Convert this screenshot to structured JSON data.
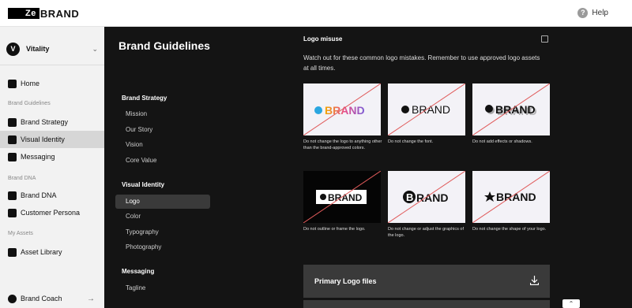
{
  "brand": {
    "logo_box": "Ze",
    "logo_rest": "BRAND"
  },
  "header": {
    "help_label": "Help",
    "help_glyph": "?"
  },
  "account": {
    "initial": "V",
    "name": "Vitality"
  },
  "sidebar": {
    "home": "Home",
    "section_guidelines": "Brand Guidelines",
    "brand_strategy": "Brand Strategy",
    "visual_identity": "Visual Identity",
    "messaging": "Messaging",
    "section_dna": "Brand DNA",
    "brand_dna": "Brand DNA",
    "customer_persona": "Customer Persona",
    "section_assets": "My Assets",
    "asset_library": "Asset Library",
    "brand_coach": "Brand Coach"
  },
  "guidelines": {
    "title": "Brand Guidelines",
    "groups": [
      {
        "heading": "Brand Strategy",
        "items": [
          "Mission",
          "Our Story",
          "Vision",
          "Core Value"
        ]
      },
      {
        "heading": "Visual Identity",
        "items": [
          "Logo",
          "Color",
          "Typography",
          "Photography"
        ]
      },
      {
        "heading": "Messaging",
        "items": [
          "Tagline"
        ]
      }
    ],
    "active_item": "Logo"
  },
  "misuse": {
    "title": "Logo misuse",
    "description": "Watch out for these common logo mistakes. Remember to use approved logo assets at all times.",
    "wordmark": "BRAND",
    "wordmark_short": "RAND",
    "examples": [
      {
        "caption": "Do not change the logo to anything other than the brand-approved colors."
      },
      {
        "caption": "Do not change the font."
      },
      {
        "caption": "Do not add effects or shadows."
      },
      {
        "caption": "Do not outline or frame the logo."
      },
      {
        "caption": "Do not change or adjust the graphics of the logo."
      },
      {
        "caption": "Do not change the shape of your logo."
      }
    ]
  },
  "files": {
    "primary_label": "Primary Logo files"
  },
  "colors": {
    "strike": "#e05a5a",
    "dark_bg": "#141414",
    "panel": "#3a3a3a",
    "dot_blue": "#2aa6e0"
  }
}
